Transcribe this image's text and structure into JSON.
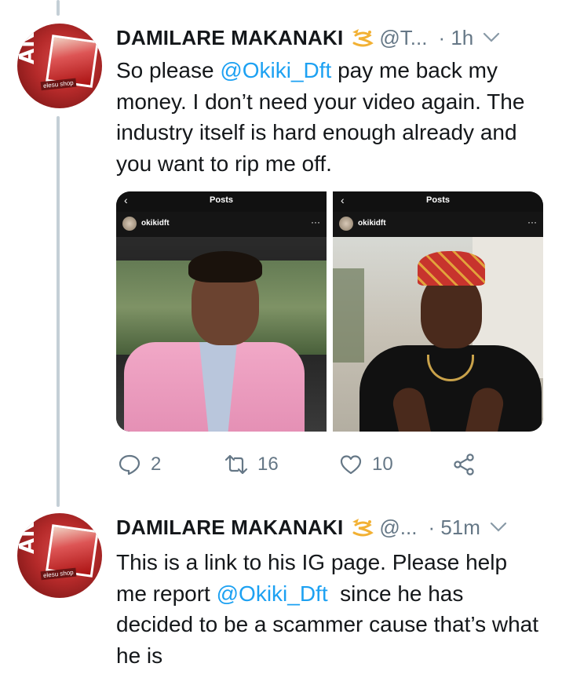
{
  "tweets": [
    {
      "name": "DAMILARE MAKANAKI",
      "badge_icon": "hand-sign-emoji",
      "handle": "@T...",
      "time": "· 1h",
      "text_parts": [
        {
          "text": "So please ",
          "mention": false
        },
        {
          "text": "@Okiki_Dft",
          "mention": true
        },
        {
          "text": " pay me back my money. I don’t need your video again. The industry itself is hard enough already and you want to rip me off.",
          "mention": false
        }
      ],
      "media": {
        "posts": [
          {
            "header": "Posts",
            "username": "okikidft",
            "dots": "···"
          },
          {
            "header": "Posts",
            "username": "okikidft",
            "dots": "···"
          }
        ]
      },
      "actions": {
        "reply_count": "2",
        "retweet_count": "16",
        "like_count": "10"
      }
    },
    {
      "name": "DAMILARE MAKANAKI",
      "badge_icon": "hand-sign-emoji",
      "handle": "@...",
      "time": "· 51m",
      "text_parts": [
        {
          "text": "This is a link to his IG page. Please help me report ",
          "mention": false
        },
        {
          "text": "@Okiki_Dft",
          "mention": true
        },
        {
          "text": "  since he has decided to be a scammer cause that’s what he is",
          "mention": false
        }
      ]
    }
  ],
  "avatar": {
    "text": "ANC",
    "caption": "elesu shop"
  },
  "colors": {
    "mention": "#1da1f2",
    "secondary": "#657786",
    "thread_line": "#c4cfd6"
  }
}
